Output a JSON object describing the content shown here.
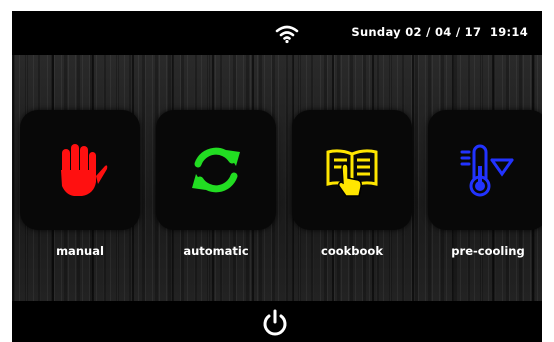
{
  "status_bar": {
    "datetime": "Sunday 02 / 04 / 17  19:14",
    "wifi_icon": "wifi-icon"
  },
  "modes": [
    {
      "label": "manual",
      "icon": "hand-stop-icon",
      "color": "#ff0000"
    },
    {
      "label": "automatic",
      "icon": "refresh-arrows-icon",
      "color": "#22dd22"
    },
    {
      "label": "cookbook",
      "icon": "open-book-touch-icon",
      "color": "#ffee00"
    },
    {
      "label": "pre-cooling",
      "icon": "thermometer-down-icon",
      "color": "#2233ff"
    }
  ],
  "footer": {
    "power_icon": "power-icon"
  }
}
